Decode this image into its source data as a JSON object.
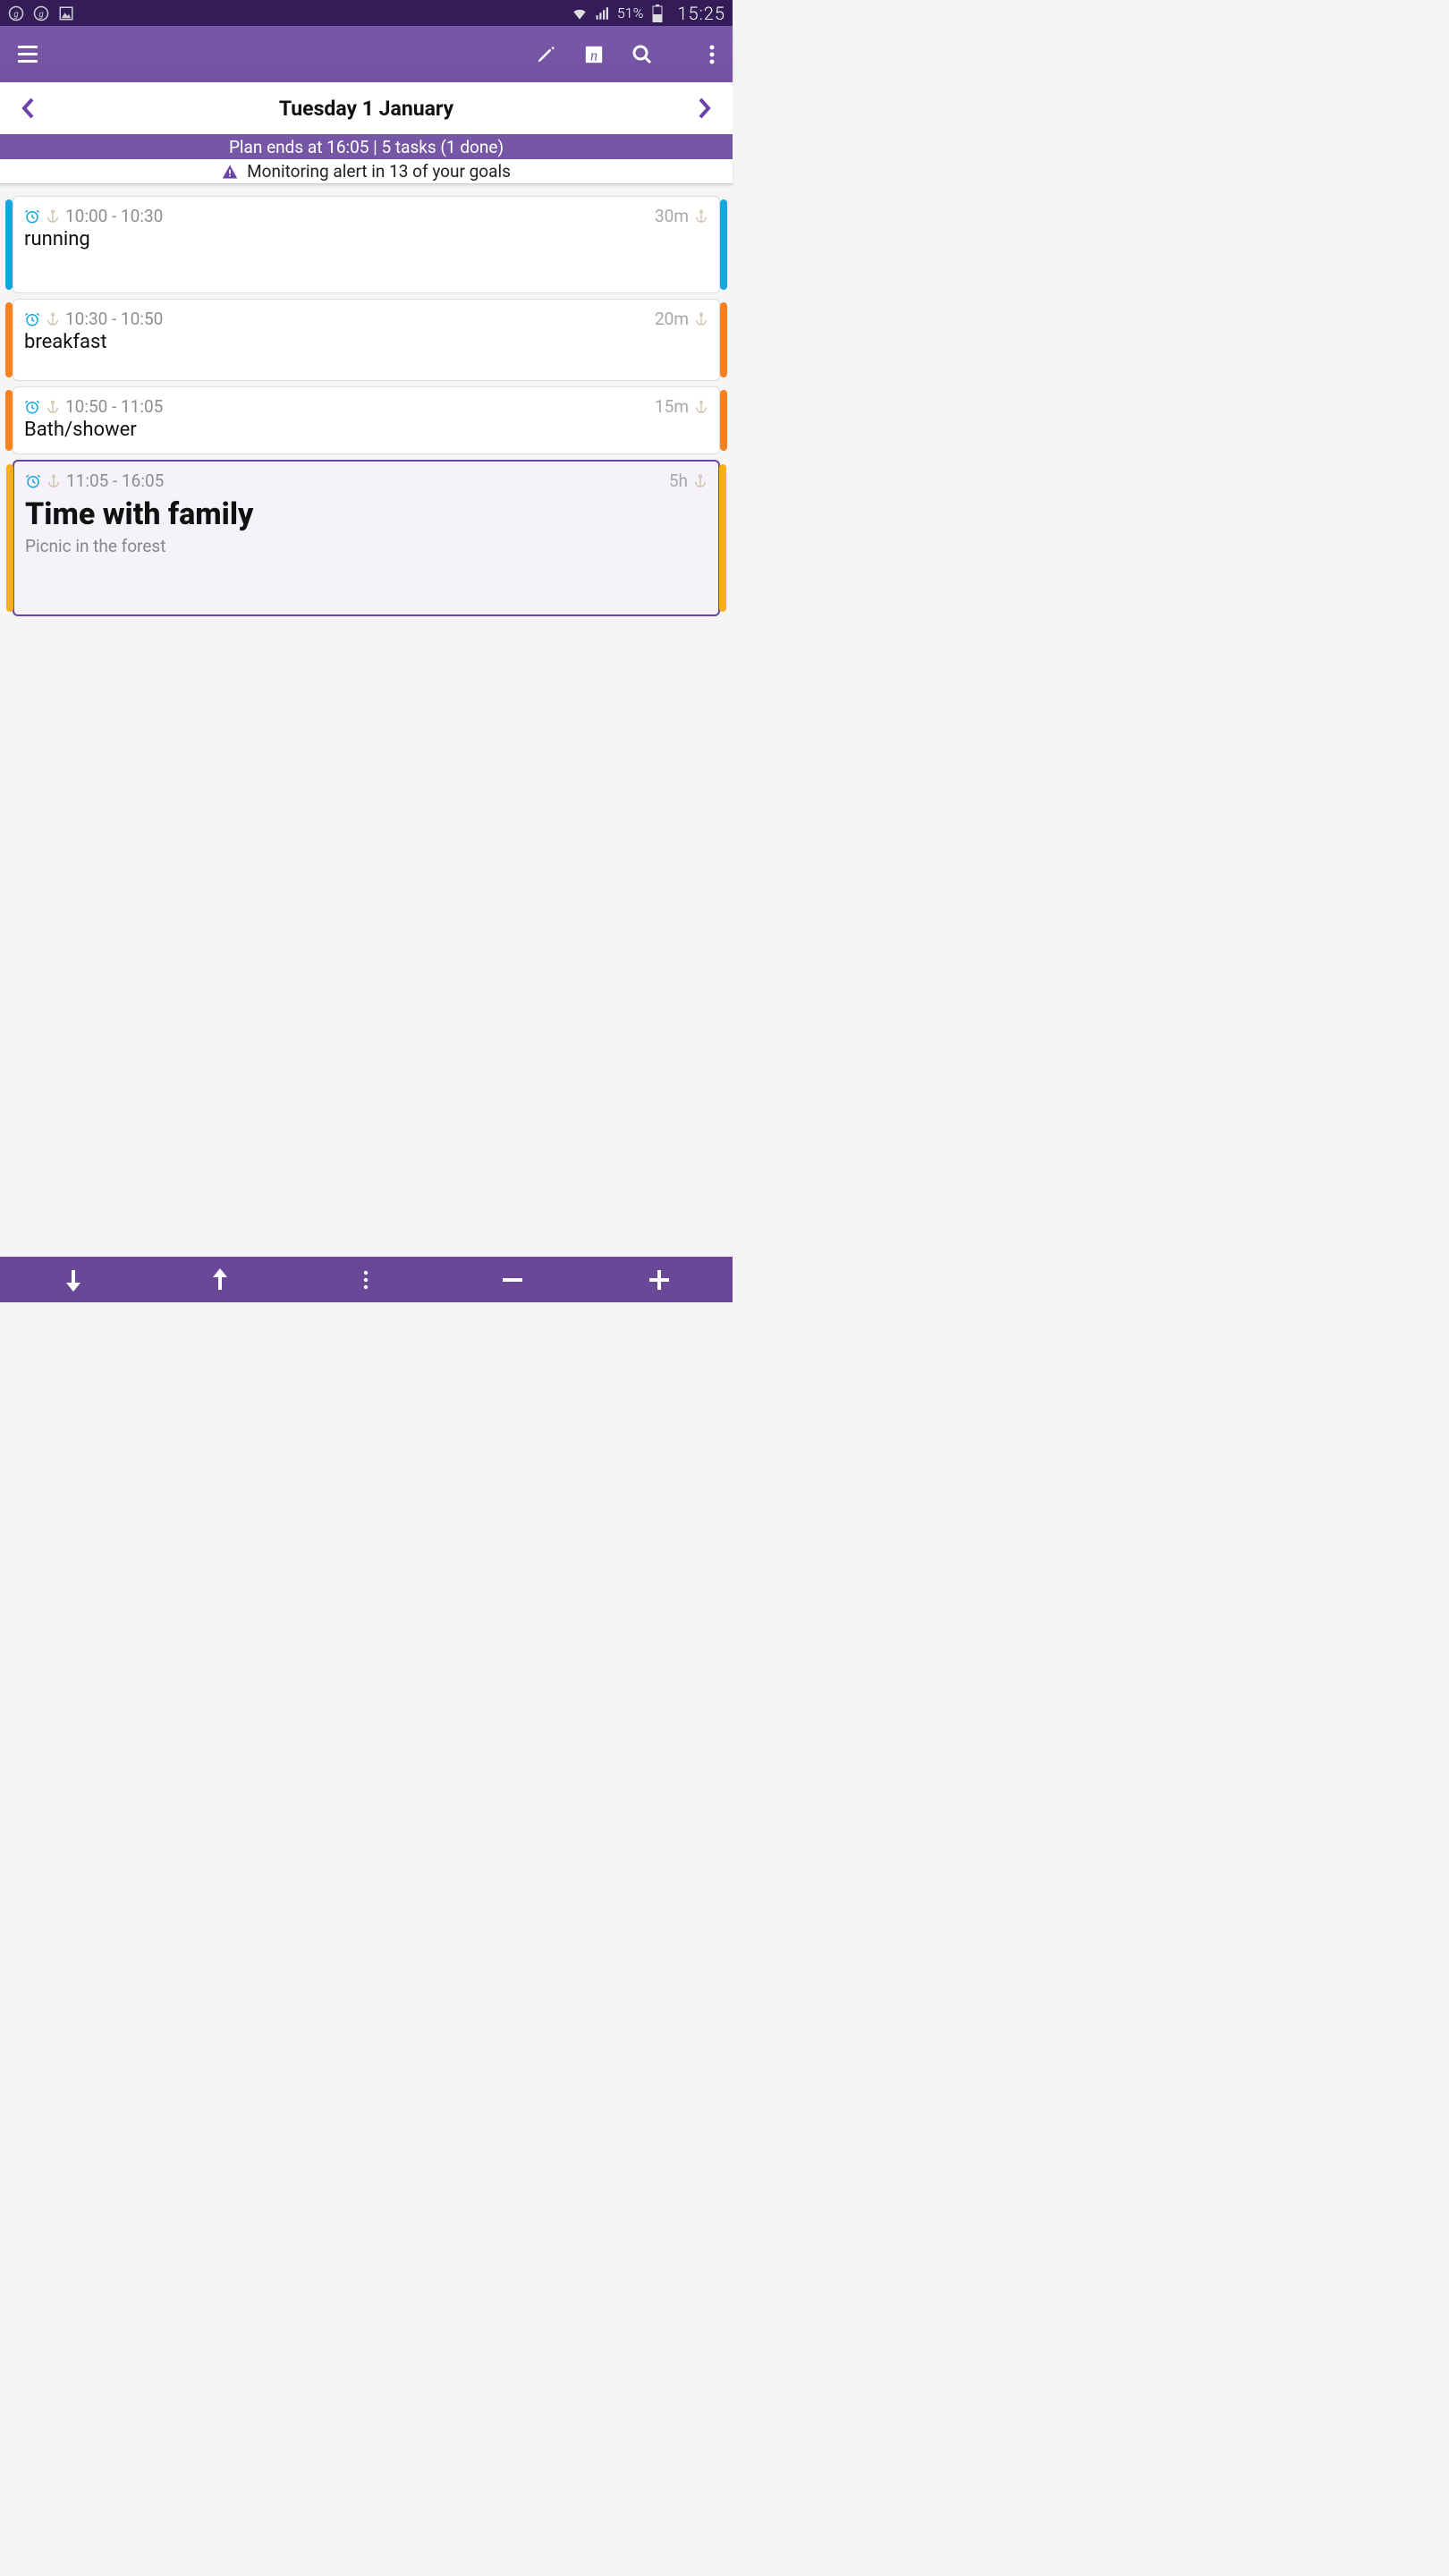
{
  "status": {
    "battery_pct": "51%",
    "time": "15:25"
  },
  "date_nav": {
    "title": "Tuesday 1 January"
  },
  "summary": "Plan ends at 16:05 | 5 tasks (1 done)",
  "alert": "Monitoring alert in 13 of your goals",
  "tasks": [
    {
      "time_range": "10:00 - 10:30",
      "duration": "30m",
      "title": "running",
      "subtitle": "",
      "color": "blue",
      "selected": false,
      "big_title": false,
      "size": "tall1"
    },
    {
      "time_range": "10:30 - 10:50",
      "duration": "20m",
      "title": "breakfast",
      "subtitle": "",
      "color": "orange",
      "selected": false,
      "big_title": false,
      "size": "short1"
    },
    {
      "time_range": "10:50 - 11:05",
      "duration": "15m",
      "title": "Bath/shower",
      "subtitle": "",
      "color": "orange",
      "selected": false,
      "big_title": false,
      "size": "short2"
    },
    {
      "time_range": "11:05 - 16:05",
      "duration": "5h",
      "title": "Time with family",
      "subtitle": "Picnic in the forest",
      "color": "amber",
      "selected": true,
      "big_title": true,
      "size": "big"
    }
  ]
}
